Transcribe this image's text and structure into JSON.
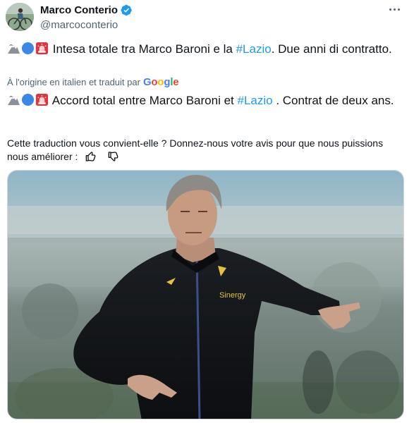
{
  "author": {
    "name": "Marco Conterio",
    "handle": "@marcoconterio",
    "verified": true,
    "avatar_icon": "avatar-photo"
  },
  "more_icon": "more-options-icon",
  "original": {
    "emojis": [
      "mountain-eagle-emoji",
      "blue-circle-emoji",
      "siren-emoji"
    ],
    "text_before": "Intesa totale tra Marco Baroni e la ",
    "hashtag": "#Lazio",
    "text_after": ". Due anni di contratto."
  },
  "translation_notice": {
    "label": "À l'origine en italien et traduit par",
    "provider": "Google"
  },
  "translated": {
    "emojis": [
      "mountain-eagle-emoji",
      "blue-circle-emoji",
      "siren-emoji"
    ],
    "text_before": "Accord total entre Marco Baroni et ",
    "hashtag": "#Lazio",
    "text_after": " . Contrat de deux ans."
  },
  "feedback": {
    "prompt": "Cette traduction vous convient-elle ? Donnez-nous votre avis pour que nous puissions nous améliorer :",
    "thumb_up_icon": "thumbs-up-icon",
    "thumb_down_icon": "thumbs-down-icon"
  },
  "media": {
    "type": "photo",
    "brand_text": "Sinergy"
  },
  "colors": {
    "accent": "#1d9bf0",
    "text": "#0f1419",
    "secondary": "#536471",
    "border": "#cfd9de"
  }
}
